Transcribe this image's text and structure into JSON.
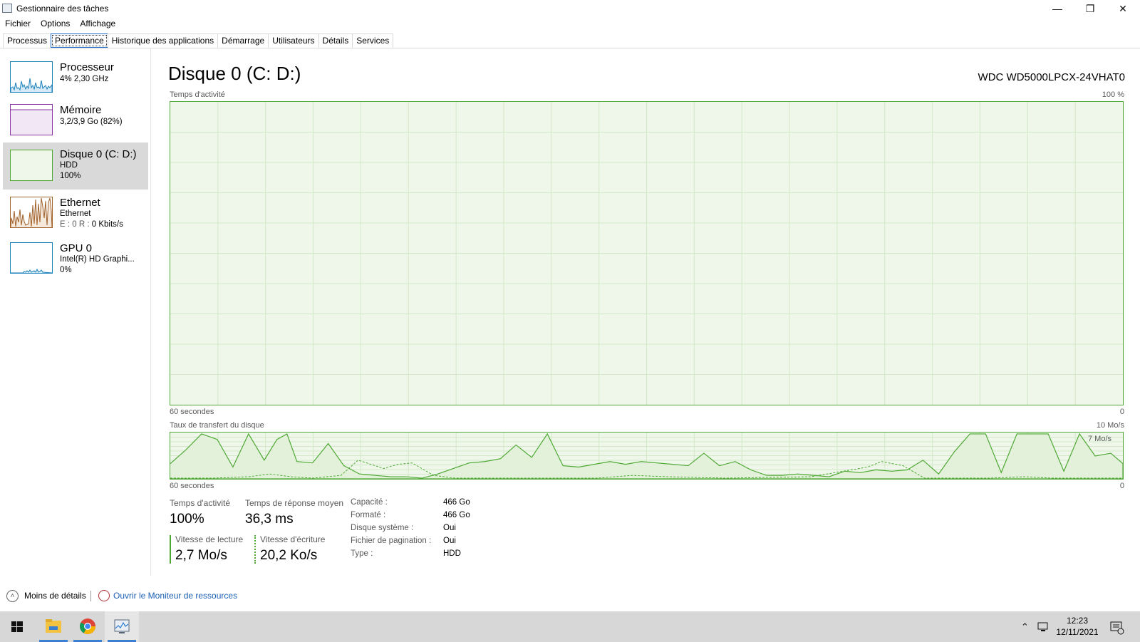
{
  "window": {
    "title": "Gestionnaire des tâches",
    "controls": {
      "minimize": "—",
      "restore": "❐",
      "close": "✕"
    }
  },
  "menu": [
    "Fichier",
    "Options",
    "Affichage"
  ],
  "tabs": [
    "Processus",
    "Performance",
    "Historique des applications",
    "Démarrage",
    "Utilisateurs",
    "Détails",
    "Services"
  ],
  "sidebar": {
    "items": [
      {
        "title": "Processeur",
        "line1": "4% 2,30 GHz",
        "line2": "",
        "color": "#1a80bb"
      },
      {
        "title": "Mémoire",
        "line1": "3,2/3,9 Go (82%)",
        "line2": "",
        "color": "#8b34a3"
      },
      {
        "title": "Disque 0 (C: D:)",
        "line1": "HDD",
        "line2": "100%",
        "color": "#4da833"
      },
      {
        "title": "Ethernet",
        "line1": "Ethernet",
        "line2_prefix": "E : 0 R :",
        "line2": "0 Kbits/s",
        "color": "#a0612a"
      },
      {
        "title": "GPU 0",
        "line1": "Intel(R) HD Graphi...",
        "line2": "0%",
        "color": "#1a80bb"
      }
    ]
  },
  "main": {
    "title": "Disque 0 (C: D:)",
    "model": "WDC WD5000LPCX-24VHAT0",
    "activity_graph": {
      "label": "Temps d'activité",
      "max": "100 %",
      "time": "60 secondes",
      "zero": "0"
    },
    "transfer_graph": {
      "label": "Taux de transfert du disque",
      "max": "10 Mo/s",
      "inner_label": "7 Mo/s",
      "time": "60 secondes",
      "zero": "0"
    },
    "stats": {
      "activity_label": "Temps d'activité",
      "activity_value": "100%",
      "response_label": "Temps de réponse moyen",
      "response_value": "36,3 ms",
      "read_label": "Vitesse de lecture",
      "read_value": "2,7 Mo/s",
      "write_label": "Vitesse d'écriture",
      "write_value": "20,2 Ko/s"
    },
    "properties": [
      {
        "label": "Capacité :",
        "value": "466 Go"
      },
      {
        "label": "Formaté :",
        "value": "466 Go"
      },
      {
        "label": "Disque système :",
        "value": "Oui"
      },
      {
        "label": "Fichier de pagination :",
        "value": "Oui"
      },
      {
        "label": "Type :",
        "value": "HDD"
      }
    ]
  },
  "footer": {
    "less_details": "Moins de détails",
    "open_monitor": "Ouvrir le Moniteur de ressources"
  },
  "taskbar": {
    "time": "12:23",
    "date": "12/11/2021"
  },
  "colors": {
    "disk_line": "#4da833",
    "disk_fill": "#eff7ea",
    "grid": "#d3e8c8"
  }
}
